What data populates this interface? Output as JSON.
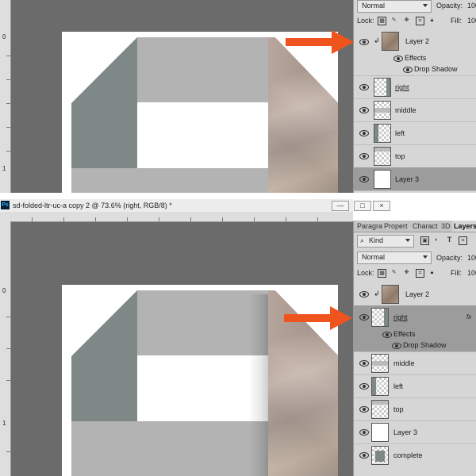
{
  "top": {
    "ruler_marks": [
      "0",
      "1"
    ],
    "blend_mode": "Normal",
    "opacity_label": "Opacity:",
    "opacity_value": "100",
    "lock_label": "Lock:",
    "fill_label": "Fill:",
    "fill_value": "100",
    "layers": [
      {
        "name": "Layer 2",
        "thumb": "photo",
        "clipped": true,
        "selected": false
      },
      {
        "name": "right",
        "thumb": "checker",
        "selected": false,
        "underline": true
      },
      {
        "name": "middle",
        "thumb": "checker",
        "selected": false
      },
      {
        "name": "left",
        "thumb": "checker",
        "selected": false
      },
      {
        "name": "top",
        "thumb": "checker",
        "selected": false
      },
      {
        "name": "Layer 3",
        "thumb": "white",
        "selected": true
      }
    ],
    "effects_label": "Effects",
    "drop_shadow_label": "Drop Shadow"
  },
  "bottom": {
    "window_title": "sd-folded-ltr-uc-a copy 2 @ 73.6% (right, RGB/8) *",
    "ps_badge": "Ps",
    "win_buttons": [
      "—",
      "□",
      "×"
    ],
    "panel_tabs": [
      "Paragra",
      "Propert",
      "Charact",
      "3D",
      "Layers"
    ],
    "kind_label": "Kind",
    "ruler_marks": [
      "0",
      "1"
    ],
    "blend_mode": "Normal",
    "opacity_label": "Opacity:",
    "opacity_value": "100",
    "lock_label": "Lock:",
    "fill_label": "Fill:",
    "fill_value": "100",
    "layers": [
      {
        "name": "Layer 2",
        "thumb": "photo",
        "clipped": true,
        "selected": false
      },
      {
        "name": "right",
        "thumb": "checker",
        "selected": true,
        "underline": true
      },
      {
        "name": "middle",
        "thumb": "checker",
        "selected": false
      },
      {
        "name": "left",
        "thumb": "checker",
        "selected": false
      },
      {
        "name": "top",
        "thumb": "checker",
        "selected": false
      },
      {
        "name": "Layer 3",
        "thumb": "white",
        "selected": false
      },
      {
        "name": "complete",
        "thumb": "checker",
        "selected": false
      }
    ],
    "effects_label": "Effects",
    "drop_shadow_label": "Drop Shadow"
  },
  "colors": {
    "arrow": "#f0541e",
    "gray_shape": "#7d8887",
    "light_gray": "#b3b3b3",
    "canvas": "#6b6b6b"
  },
  "icons": [
    "eye-icon",
    "chain-link-icon",
    "fx-icon",
    "lock-transparency-icon",
    "lock-paint-icon",
    "lock-move-icon",
    "lock-artboard-icon",
    "lock-all-icon",
    "search-icon",
    "pixel-filter-icon",
    "adjust-filter-icon",
    "type-filter-icon",
    "shape-filter-icon"
  ]
}
